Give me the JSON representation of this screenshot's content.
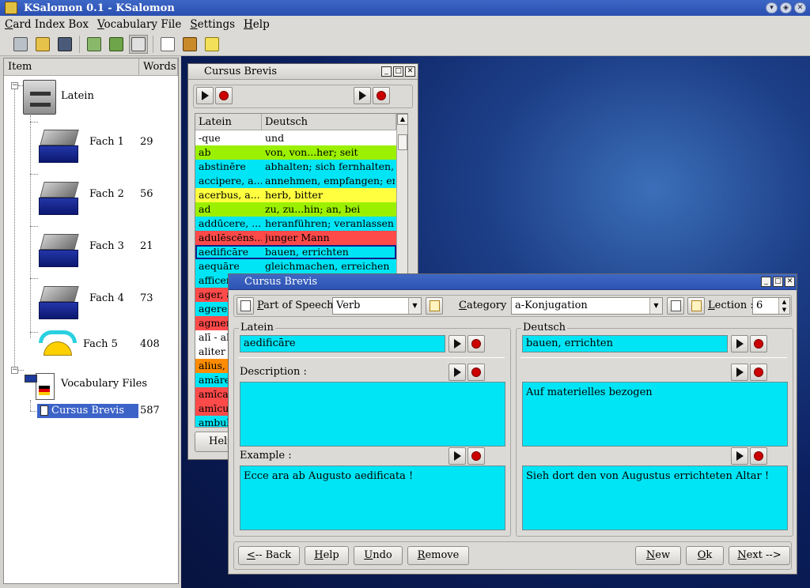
{
  "app": {
    "title": "KSalomon 0.1 - KSalomon"
  },
  "menubar": [
    "Card Index Box",
    "Vocabulary File",
    "Settings",
    "Help"
  ],
  "tree": {
    "columns": [
      "Item",
      "Words"
    ],
    "root": "Latein",
    "fach": [
      {
        "label": "Fach 1",
        "count": "29"
      },
      {
        "label": "Fach 2",
        "count": "56"
      },
      {
        "label": "Fach 3",
        "count": "21"
      },
      {
        "label": "Fach 4",
        "count": "73"
      },
      {
        "label": "Fach 5",
        "count": "408"
      }
    ],
    "vocab_root": "Vocabulary Files",
    "vocab_file": {
      "label": "Cursus Brevis",
      "count": "587"
    }
  },
  "win1": {
    "title": "Cursus Brevis",
    "columns": [
      "Latein",
      "Deutsch"
    ],
    "rows": [
      {
        "la": "-que",
        "de": "und",
        "color": "#ffffff"
      },
      {
        "la": "ab",
        "de": "von, von...her; seit",
        "color": "#9bf000"
      },
      {
        "la": "abstinēre",
        "de": "abhalten; sich fernhalten, ...",
        "color": "#00e5f5"
      },
      {
        "la": "accipere, a...",
        "de": "annehmen, empfangen; er...",
        "color": "#00e5f5"
      },
      {
        "la": "acerbus, a...",
        "de": "herb, bitter",
        "color": "#ffff40"
      },
      {
        "la": "ad",
        "de": "zu, zu...hin; an, bei",
        "color": "#9bf000"
      },
      {
        "la": "addūcere, ...",
        "de": "heranführen; veranlassen",
        "color": "#00e5f5"
      },
      {
        "la": "adulēscēns...",
        "de": "junger Mann",
        "color": "#ff4a4a"
      },
      {
        "la": "aedificāre",
        "de": "bauen, errichten",
        "color": "#00e5f5",
        "selected": true
      },
      {
        "la": "aequāre",
        "de": "gleichmachen, erreichen",
        "color": "#00e5f5"
      },
      {
        "la": "afficer",
        "de": "",
        "color": "#00e5f5"
      },
      {
        "la": "ager, a",
        "de": "",
        "color": "#ff4a4a"
      },
      {
        "la": "agere",
        "de": "",
        "color": "#00e5f5"
      },
      {
        "la": "agmen",
        "de": "",
        "color": "#ff4a4a"
      },
      {
        "la": "alī - al",
        "de": "",
        "color": "#ffffff"
      },
      {
        "la": "aliter",
        "de": "",
        "color": "#ffffff"
      },
      {
        "la": "alius, a",
        "de": "",
        "color": "#ff8c00"
      },
      {
        "la": "amāre",
        "de": "",
        "color": "#00e5f5"
      },
      {
        "la": "amīca",
        "de": "",
        "color": "#ff4a4a"
      },
      {
        "la": "amīcus",
        "de": "",
        "color": "#ff4a4a"
      },
      {
        "la": "ambula",
        "de": "",
        "color": "#00e5f5"
      }
    ],
    "help_label": "Help"
  },
  "win2": {
    "title": "Cursus Brevis",
    "part_of_speech_label": "Part of Speech :",
    "part_of_speech": "Verb",
    "category_label": "Category :",
    "category": "a-Konjugation",
    "lection_label": "Lection :",
    "lection": "6",
    "left_group": "Latein",
    "right_group": "Deutsch",
    "latin_word": "aedificāre",
    "german_word": "bauen, errichten",
    "description_label": "Description :",
    "latin_description": "",
    "german_description": "Auf materielles bezogen",
    "example_label": "Example :",
    "latin_example": "Ecce ara ab Augusto aedificata !",
    "german_example": "Sieh dort den von Augustus errichteten Altar !",
    "buttons": {
      "back": "<-- Back",
      "help": "Help",
      "undo": "Undo",
      "remove": "Remove",
      "new": "New",
      "ok": "Ok",
      "next": "Next -->"
    }
  }
}
